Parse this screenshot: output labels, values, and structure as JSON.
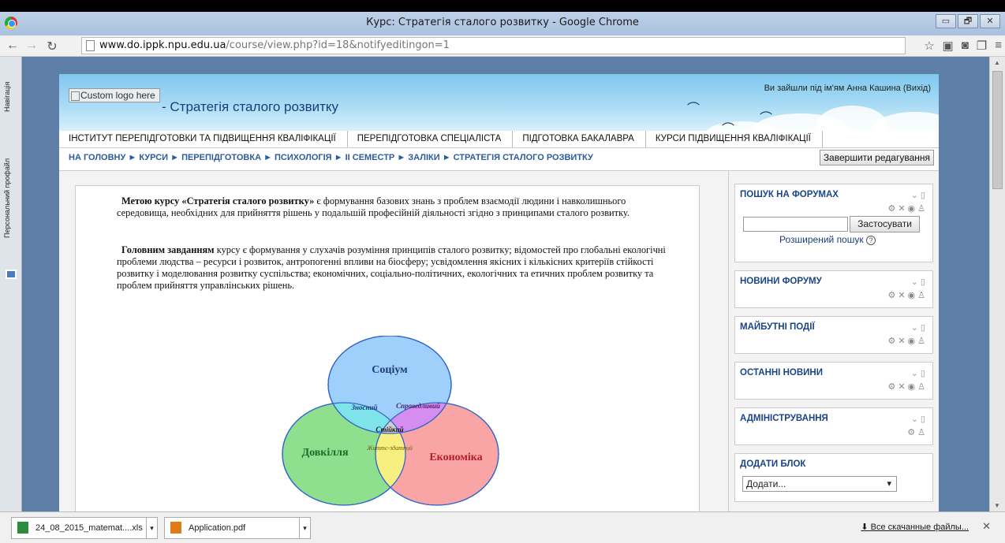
{
  "window": {
    "title": "Курс: Стратегія сталого розвитку - Google Chrome",
    "buttons": [
      "▭",
      "🗗",
      "✕"
    ]
  },
  "browser": {
    "url_host": "www.do.ippk.npu.edu.ua",
    "url_path": "/course/view.php?id=18&notifyeditingon=1"
  },
  "sidetabs": {
    "nav": "Навігація",
    "profile": "Персональний профайл"
  },
  "site": {
    "logo_alt": "Custom logo here",
    "name": "- Стратегія сталого розвитку",
    "login_info": "Ви зайшли під ім'ям Анна Кашина (Вихід)",
    "menu": [
      "ІНСТИТУТ ПЕРЕПІДГОТОВКИ ТА ПІДВИЩЕННЯ КВАЛІФІКАЦІЇ",
      "ПЕРЕПІДГОТОВКА СПЕЦІАЛІСТА",
      "ПІДГОТОВКА БАКАЛАВРА",
      "КУРСИ ПІДВИЩЕННЯ КВАЛІФІКАЦІЇ"
    ],
    "breadcrumb": "НА ГОЛОВНУ ► КУРСИ ► ПЕРЕПІДГОТОВКА ► ПСИХОЛОГІЯ ► ІІ СЕМЕСТР ► ЗАЛІКИ ► СТРАТЕГІЯ СТАЛОГО РОЗВИТКУ",
    "edit_button": "Завершити редагування"
  },
  "content": {
    "p1_bold": "Метою курсу «Стратегія сталого розвитку»",
    "p1_rest": " є формування базових знань з проблем взаємодії людини і навколишнього середовища, необхідних для прийняття рішень у подальшій професійній діяльності згідно з принципами сталого розвитку.",
    "p2_bold": "Головним завданням",
    "p2_rest": " курсу є формування у слухачів розуміння принципів сталого розвитку; відомостей про глобальні екологічні проблеми людства – ресурси і розвиток, антропогенні впливи на біосферу; усвідомлення якісних і кількісних критеріїв стійкості розвитку і моделювання розвитку суспільства; економічних, соціально-політичних, екологічних та етичних проблем розвитку та проблем прийняття управлінських рішень.",
    "venn": {
      "social": "Соціум",
      "env": "Довкілля",
      "econ": "Економіка",
      "bearable": "Зносний",
      "equitable": "Справедливий",
      "sustainable": "Стійкий",
      "viable": "Життє-здатний"
    },
    "venn_colors": {
      "social": "#9fcffb",
      "env": "#8ee08e",
      "econ": "#f9a5a5",
      "social_env": "#7fe3ea",
      "social_econ": "#d58ef0",
      "env_econ": "#f7ef80",
      "center": "#cfcfcf"
    }
  },
  "blocks": {
    "forum_search": {
      "title": "ПОШУК НА ФОРУМАХ",
      "button": "Застосувати",
      "advanced": "Розширений пошук"
    },
    "news": {
      "title": "НОВИНИ ФОРУМУ"
    },
    "events": {
      "title": "МАЙБУТНІ ПОДІЇ"
    },
    "latest": {
      "title": "ОСТАННІ НОВИНИ"
    },
    "admin": {
      "title": "АДМІНІСТРУВАННЯ"
    },
    "add": {
      "title": "ДОДАТИ БЛОК",
      "select": "Додати..."
    }
  },
  "downloads": {
    "file1": "24_08_2015_matemat....xls",
    "file2": "Application.pdf",
    "all": "Все скачанные файлы...",
    "close": "✕"
  }
}
